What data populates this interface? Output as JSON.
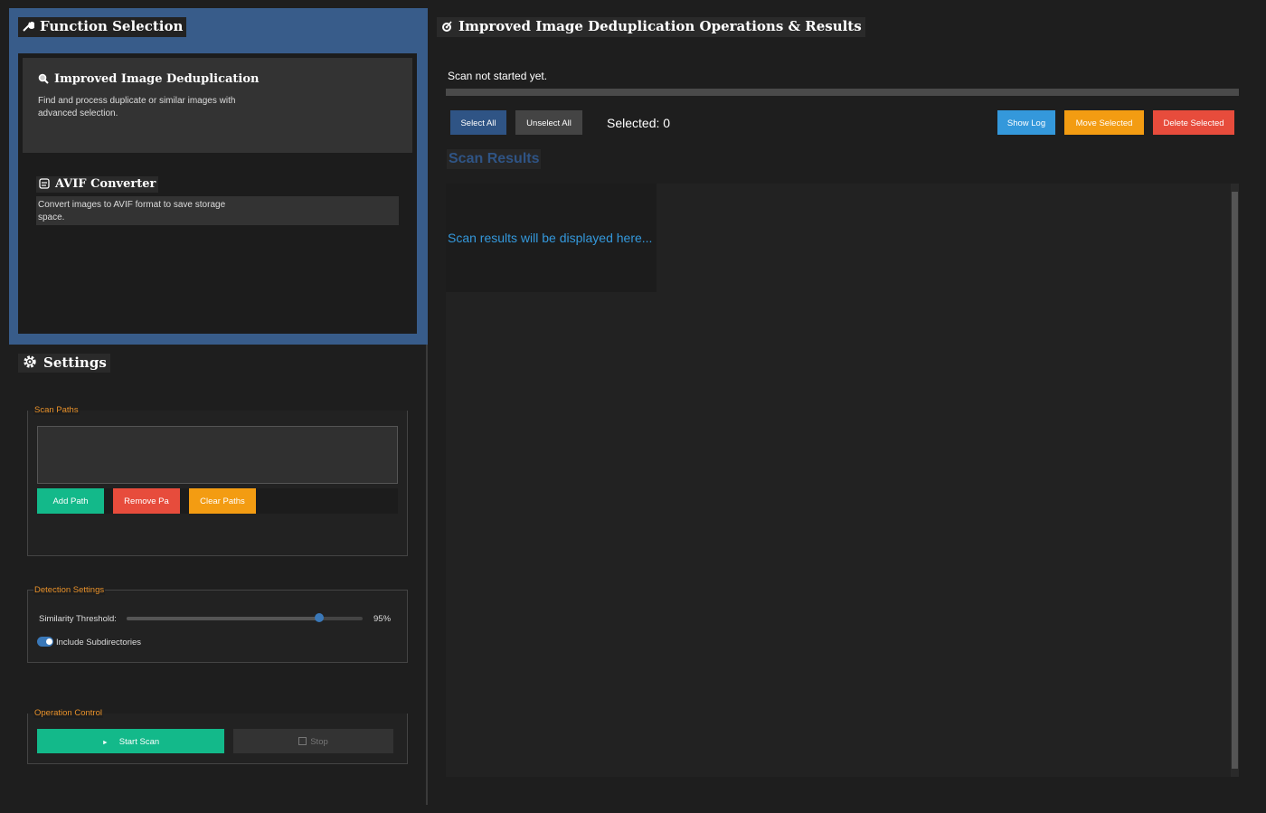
{
  "function_panel": {
    "title": "Function Selection",
    "title_icon": "wrench-icon",
    "cards": [
      {
        "title": "Improved Image Deduplication",
        "icon": "magnifier-icon",
        "description": "Find and process duplicate or similar images with advanced selection."
      },
      {
        "title": "AVIF Converter",
        "icon": "image-icon",
        "description": "Convert images to AVIF format to save storage space."
      }
    ]
  },
  "settings": {
    "title": "Settings",
    "title_icon": "gear-icon",
    "scan_paths": {
      "label": "Scan Paths",
      "add_label": "Add Path",
      "remove_label": "Remove Pa",
      "clear_label": "Clear Paths"
    },
    "detection": {
      "label": "Detection Settings",
      "similarity_label": "Similarity Threshold:",
      "similarity_value": "95%",
      "similarity_fraction": 0.95,
      "subdirs_label": "Include Subdirectories",
      "subdirs_on": true
    },
    "operation": {
      "label": "Operation Control",
      "start_label": "Start Scan",
      "start_icon": "play-icon",
      "stop_label": "Stop",
      "stop_icon": "stop-icon"
    }
  },
  "results_panel": {
    "title": "Improved Image Deduplication Operations & Results",
    "title_icon": "target-icon",
    "status": "Scan not started yet.",
    "select_all_label": "Select All",
    "unselect_all_label": "Unselect All",
    "selected_label": "Selected: 0",
    "show_log_label": "Show Log",
    "move_selected_label": "Move Selected",
    "delete_selected_label": "Delete Selected",
    "results_title": "Scan Results",
    "placeholder": "Scan results will be displayed here..."
  },
  "colors": {
    "accent_blue": "#385c8a",
    "green": "#13b98a",
    "red": "#e74c3c",
    "orange": "#f39c12",
    "light_blue": "#3498db"
  }
}
